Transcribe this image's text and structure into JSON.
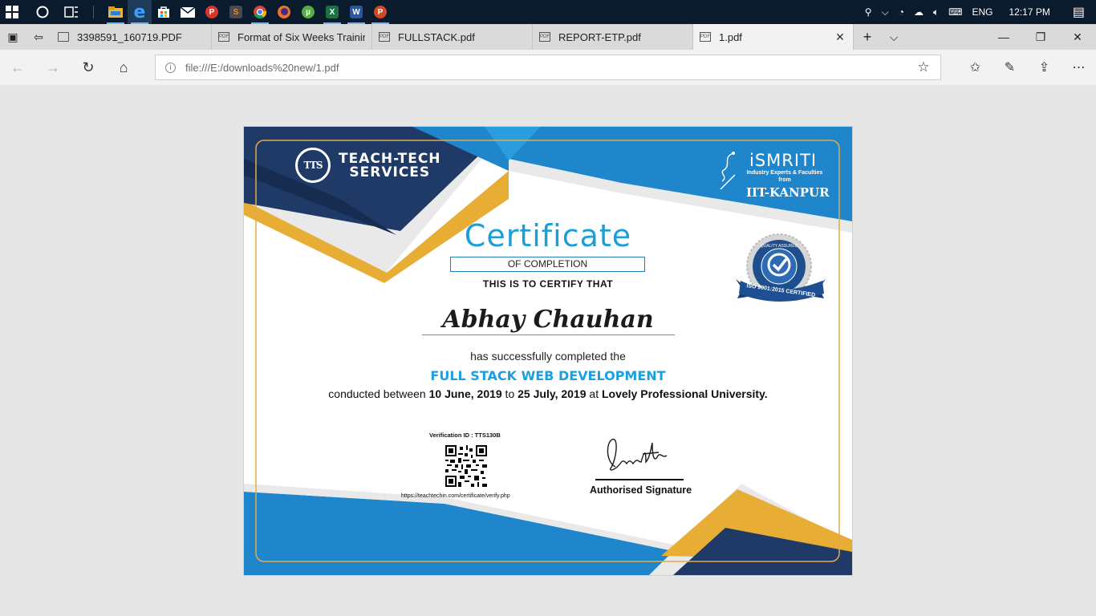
{
  "taskbar": {
    "apps": [
      {
        "name": "start-icon",
        "glyph": "⊞"
      },
      {
        "name": "cortana-icon",
        "glyph": "○"
      },
      {
        "name": "task-view-icon",
        "glyph": "☰"
      },
      {
        "name": "file-explorer-icon",
        "glyph": "",
        "color": "#e8b43a"
      },
      {
        "name": "edge-icon",
        "glyph": "e",
        "color": "#1e7fd6"
      },
      {
        "name": "store-icon",
        "glyph": "▣",
        "color": "#ffffff"
      },
      {
        "name": "mail-icon",
        "glyph": "✉",
        "color": "#ffffff"
      },
      {
        "name": "app-p-icon",
        "glyph": "P",
        "color": "#d9352b"
      },
      {
        "name": "sublime-icon",
        "glyph": "S",
        "color": "#f08a1f"
      },
      {
        "name": "chrome-icon",
        "glyph": "◉",
        "color": "#2e9b48"
      },
      {
        "name": "firefox-icon",
        "glyph": "●",
        "color": "#f3701f"
      },
      {
        "name": "utorrent-icon",
        "glyph": "µ",
        "color": "#55b043"
      },
      {
        "name": "excel-icon",
        "glyph": "X",
        "color": "#1e7145"
      },
      {
        "name": "word-icon",
        "glyph": "W",
        "color": "#2b579a"
      },
      {
        "name": "powerpoint-icon",
        "glyph": "P",
        "color": "#d24726"
      }
    ],
    "tray": {
      "language": "ENG",
      "time": "12:17 PM"
    }
  },
  "browser": {
    "tabs": [
      {
        "title": "3398591_160719.PDF",
        "active": false
      },
      {
        "title": "Format of Six Weeks Trainin",
        "active": false
      },
      {
        "title": "FULLSTACK.pdf",
        "active": false
      },
      {
        "title": "REPORT-ETP.pdf",
        "active": false
      },
      {
        "title": "1.pdf",
        "active": true
      }
    ],
    "url": "file:///E:/downloads%20new/1.pdf"
  },
  "certificate": {
    "org_left_logo": "TTS",
    "org_left_name_line1": "TEACH-TECH",
    "org_left_name_line2": "SERVICES",
    "org_right_name": "iSMRITI",
    "org_right_sub_line1": "Industry Experts & Faculties",
    "org_right_sub_line2": "from",
    "org_right_place": "IIT-KANPUR",
    "title": "Certificate",
    "subtitle": "OF COMPLETION",
    "certify_text": "THIS IS TO CERTIFY THAT",
    "recipient": "Abhay Chauhan",
    "completed_text": "has successfully completed the",
    "course": "FULL STACK WEB DEVELOPMENT",
    "conducted_prefix": "conducted between ",
    "start_date": "10 June, 2019",
    "to_text": " to ",
    "end_date": "25 July, 2019",
    "at_text": " at ",
    "institution": "Lovely Professional University.",
    "verification_id": "Verification ID : TTS130B",
    "verification_url": "https://teachtechin.com/certificate/verify.php",
    "signature_label": "Authorised Signature",
    "seal_text": "ISO 9001:2015 CERTIFIED",
    "seal_arc_text": "QUALITY ASSURED"
  },
  "colors": {
    "navy": "#1f3a66",
    "blue": "#1f86cc",
    "gold": "#e8ad35",
    "cyan_text": "#1aa0d6"
  }
}
